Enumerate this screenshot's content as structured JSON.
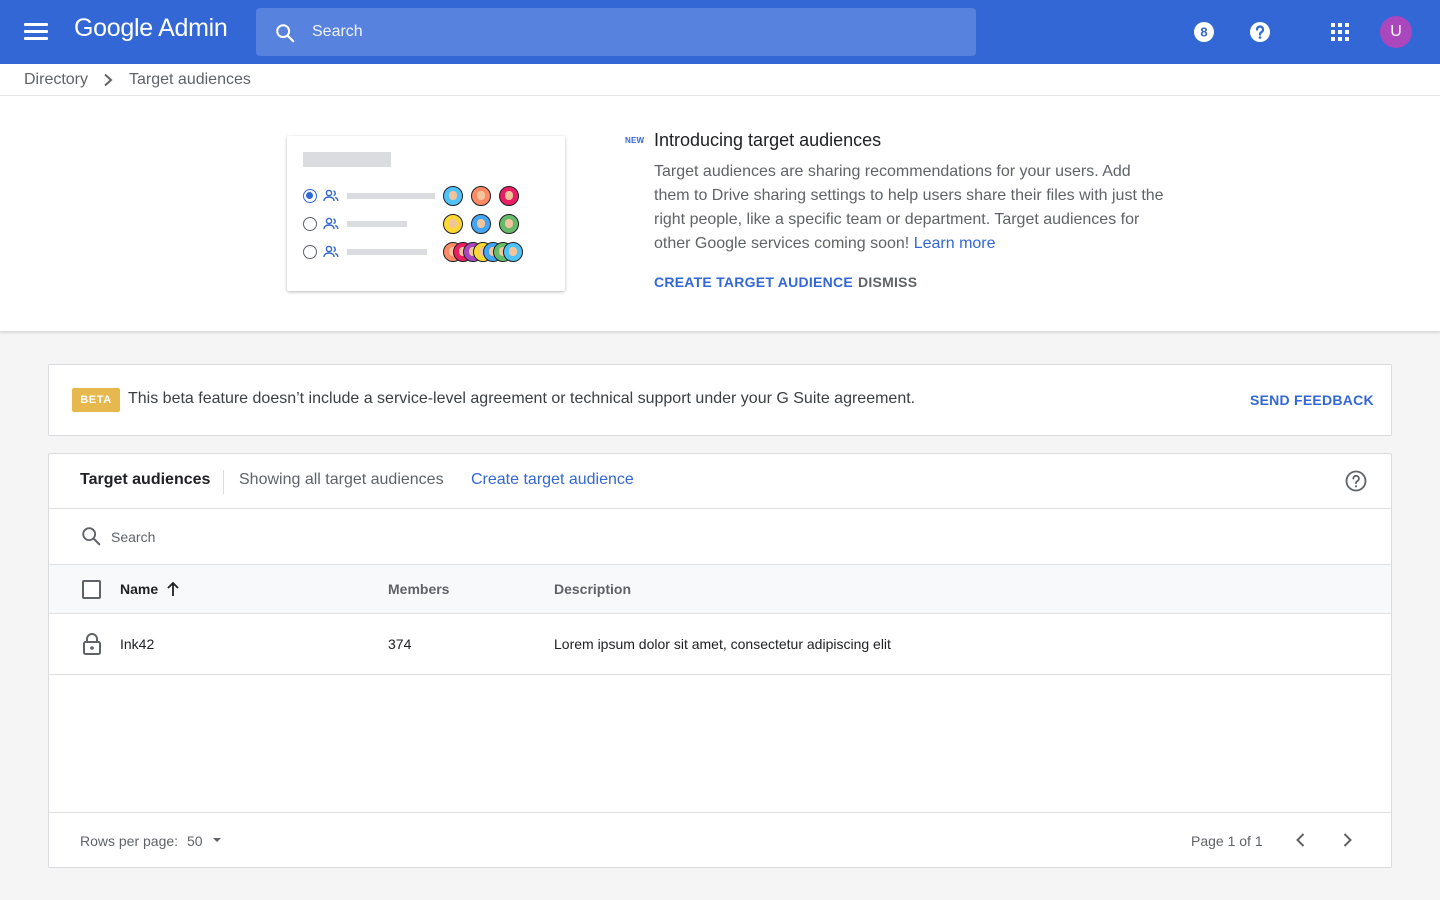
{
  "topbar": {
    "logo_google": "Google",
    "logo_product": "Admin",
    "search_placeholder": "Search",
    "support_icon_label": "8",
    "avatar_initial": "U",
    "bar_color": "#3367d6",
    "avatar_color": "#ab47bc"
  },
  "breadcrumb": {
    "items": [
      "Directory",
      "Target audiences"
    ]
  },
  "intro": {
    "badge": "NEW",
    "title": "Introducing target audiences",
    "body": "Target audiences are sharing recommendations for your users. Add them to Drive sharing settings to help users share their files with just the right people, like a specific team or department. Target audiences for other Google services coming soon!",
    "learn_more": "Learn more",
    "create_label": "CREATE TARGET AUDIENCE",
    "dismiss_label": "DISMISS"
  },
  "beta": {
    "badge": "BETA",
    "message": "This beta feature doesn’t include a service-level agreement or technical support under your G Suite agreement.",
    "feedback_label": "SEND FEEDBACK",
    "badge_color": "#e6b84d"
  },
  "table": {
    "title": "Target audiences",
    "showing": "Showing all target audiences",
    "create_link": "Create target audience",
    "search_placeholder": "Search",
    "columns": {
      "name": "Name",
      "members": "Members",
      "description": "Description"
    },
    "rows": [
      {
        "name": "Ink42",
        "members": "374",
        "description": "Lorem ipsum dolor sit amet, consectetur adipiscing elit",
        "icon": "lock-icon"
      }
    ],
    "footer": {
      "rows_per_page_label": "Rows per page:",
      "rows_per_page_value": "50",
      "page_info": "Page 1 of 1"
    }
  }
}
